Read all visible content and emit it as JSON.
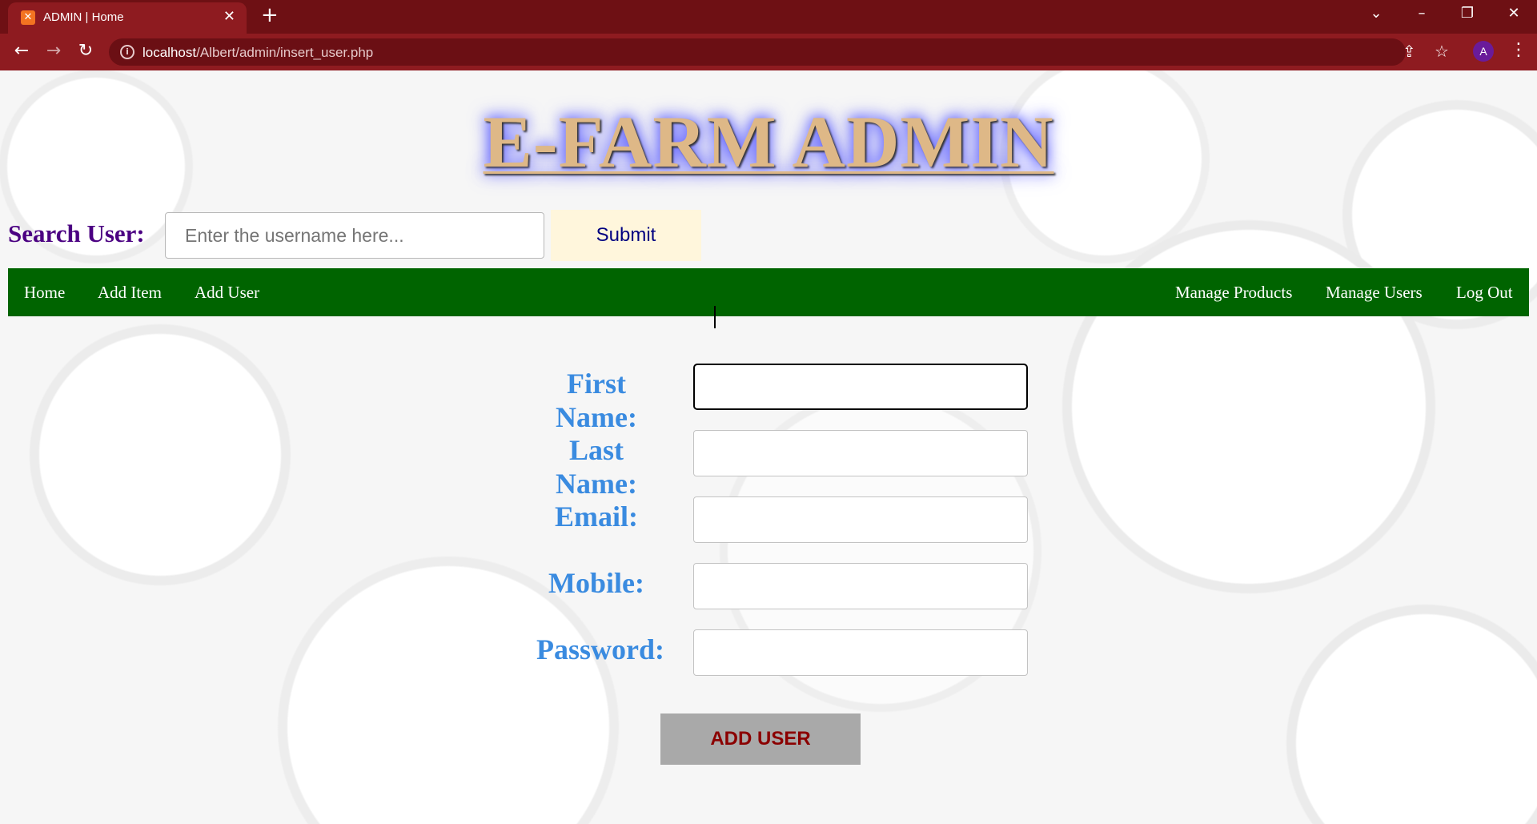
{
  "browser": {
    "tab_title": "ADMIN | Home",
    "url_host": "localhost",
    "url_path": "/Albert/admin/insert_user.php",
    "profile_initial": "A",
    "icons": [
      "xampp-favicon",
      "close-icon",
      "plus-icon",
      "chevron-down-icon",
      "minimize-icon",
      "restore-icon",
      "close-window-icon",
      "back-arrow-icon",
      "forward-arrow-icon",
      "reload-icon",
      "info-icon",
      "share-icon",
      "star-icon",
      "kebab-menu-icon"
    ]
  },
  "header": {
    "title": "E-FARM ADMIN"
  },
  "search": {
    "label": "Search User:",
    "placeholder": "Enter the username here...",
    "value": "",
    "submit_label": "Submit"
  },
  "nav": {
    "left": [
      "Home",
      "Add Item",
      "Add User"
    ],
    "right": [
      "Manage Products",
      "Manage Users",
      "Log Out"
    ]
  },
  "form": {
    "fields": [
      {
        "label": "First Name:",
        "value": "",
        "focused": true
      },
      {
        "label": "Last Name:",
        "value": ""
      },
      {
        "label": "Email:",
        "value": ""
      },
      {
        "label": "Mobile:",
        "value": ""
      },
      {
        "label": "Password:",
        "value": ""
      }
    ],
    "submit_label": "ADD USER"
  },
  "colors": {
    "chrome_tabstrip": "#6e1014",
    "chrome_toolbar": "#8e1b20",
    "title_fill": "#deb887",
    "title_glow": "#5a5cff",
    "search_label": "#4b0082",
    "submit_bg": "#fff6dc",
    "submit_text": "#000080",
    "navbar_bg": "#006400",
    "field_label": "#3a8be0",
    "add_button_bg": "#a9a9a9",
    "add_button_text": "#8b0000"
  }
}
